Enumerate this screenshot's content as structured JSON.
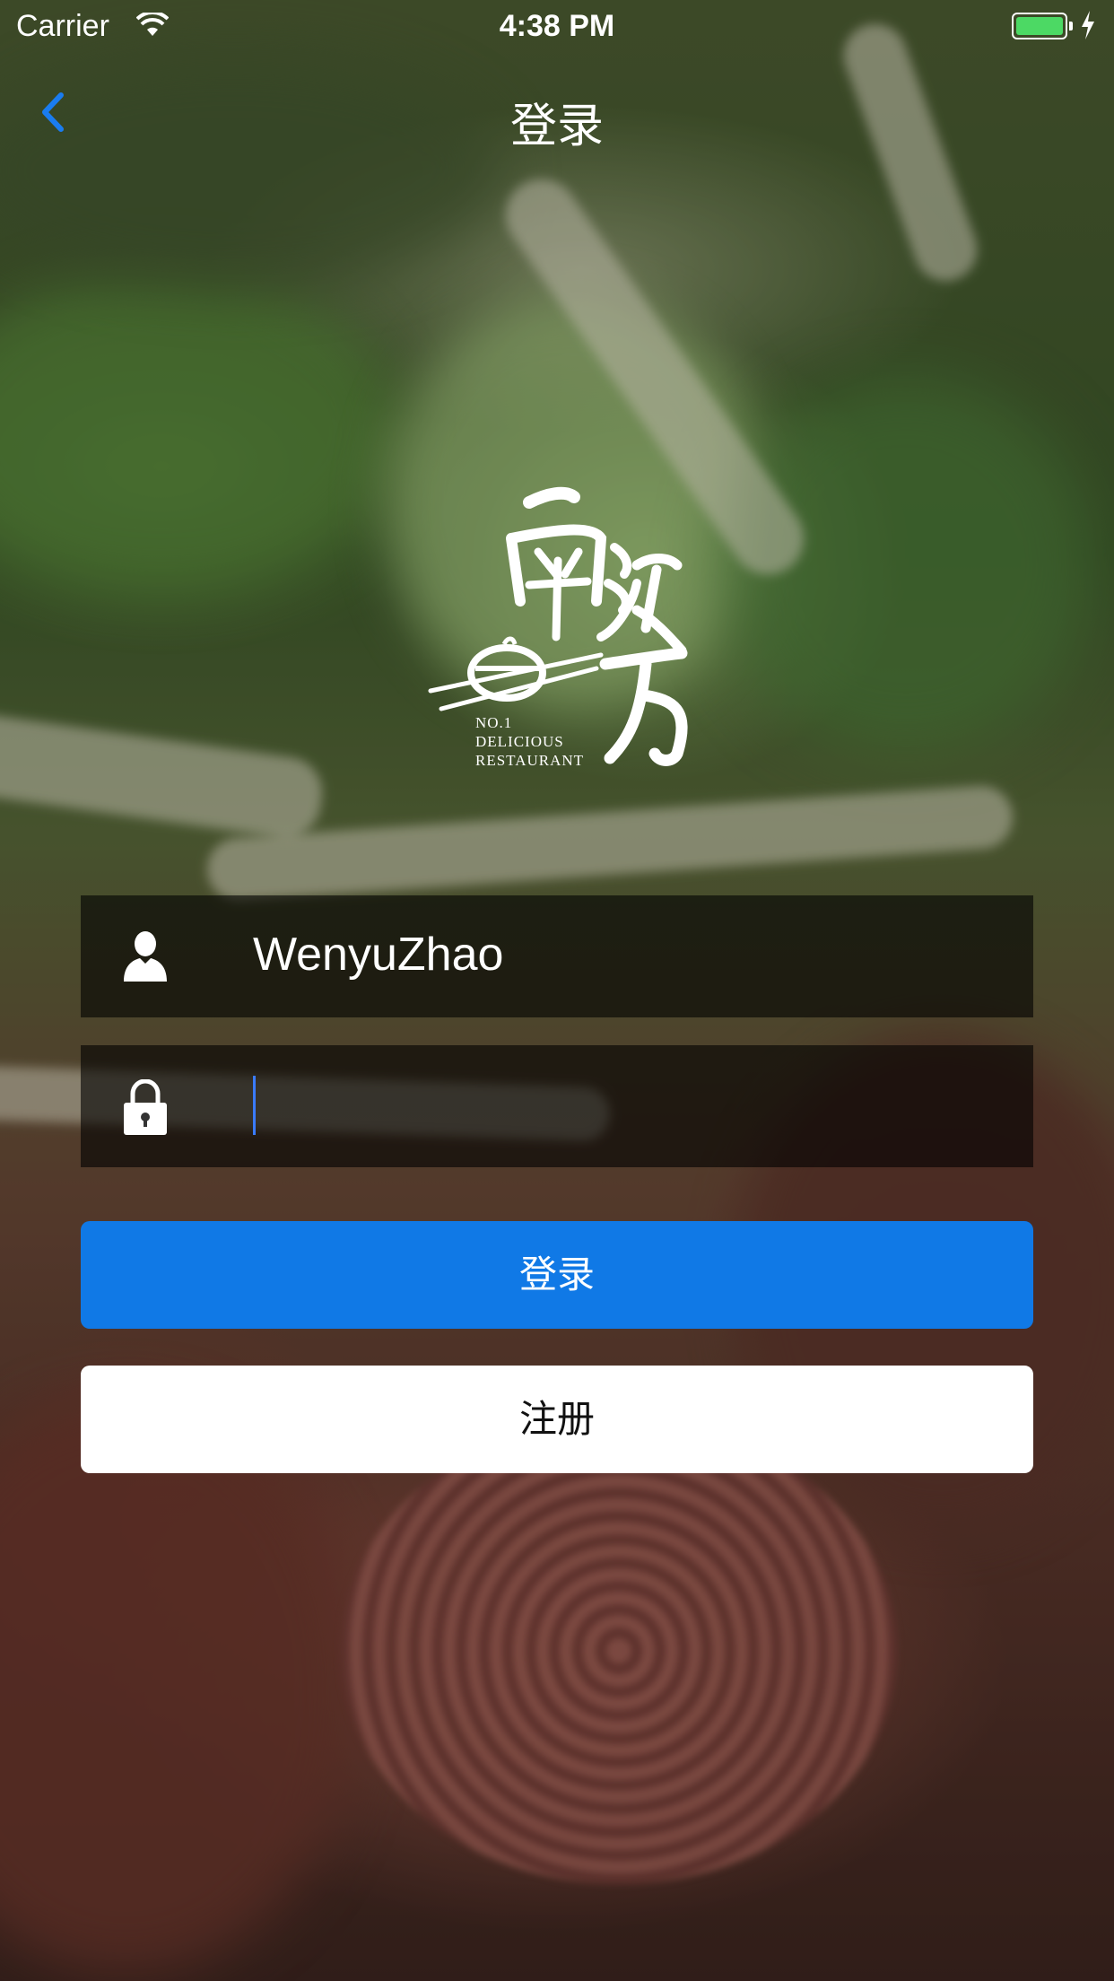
{
  "status_bar": {
    "carrier": "Carrier",
    "time": "4:38 PM",
    "wifi_icon": "wifi-icon",
    "battery_icon": "battery-icon",
    "charging_icon": "bolt-icon",
    "battery_color": "#4cd964"
  },
  "nav": {
    "title": "登录",
    "back_icon": "chevron-left-icon",
    "back_color": "#1a7cf0"
  },
  "logo": {
    "text_lines": [
      "NO.1",
      "DELICIOUS",
      "RESTAURANT"
    ]
  },
  "form": {
    "username": {
      "value": "WenyuZhao",
      "icon": "user-icon"
    },
    "password": {
      "value": "",
      "icon": "lock-icon"
    }
  },
  "buttons": {
    "login_label": "登录",
    "register_label": "注册",
    "login_color": "#1079e6"
  }
}
